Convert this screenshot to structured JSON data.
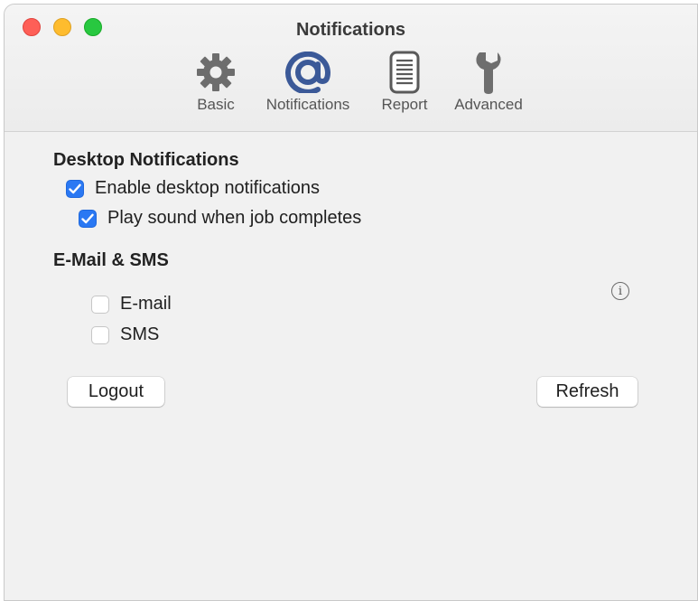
{
  "window": {
    "title": "Notifications"
  },
  "toolbar": {
    "tabs": [
      {
        "label": "Basic",
        "icon": "gear-icon"
      },
      {
        "label": "Notifications",
        "icon": "at-sign-icon",
        "selected": true
      },
      {
        "label": "Report",
        "icon": "report-document-icon"
      },
      {
        "label": "Advanced",
        "icon": "wrench-icon"
      }
    ]
  },
  "desktop": {
    "heading": "Desktop Notifications",
    "enable": {
      "label": "Enable desktop notifications",
      "checked": true
    },
    "sound": {
      "label": "Play sound when job completes",
      "checked": true
    }
  },
  "email_sms": {
    "heading": "E-Mail & SMS",
    "email": {
      "label": "E-mail",
      "checked": false
    },
    "sms": {
      "label": "SMS",
      "checked": false
    },
    "info_glyph": "i"
  },
  "buttons": {
    "logout": "Logout",
    "refresh": "Refresh"
  },
  "colors": {
    "accent": "#2a78f3",
    "tab_icon_selected": "#3b5998"
  }
}
